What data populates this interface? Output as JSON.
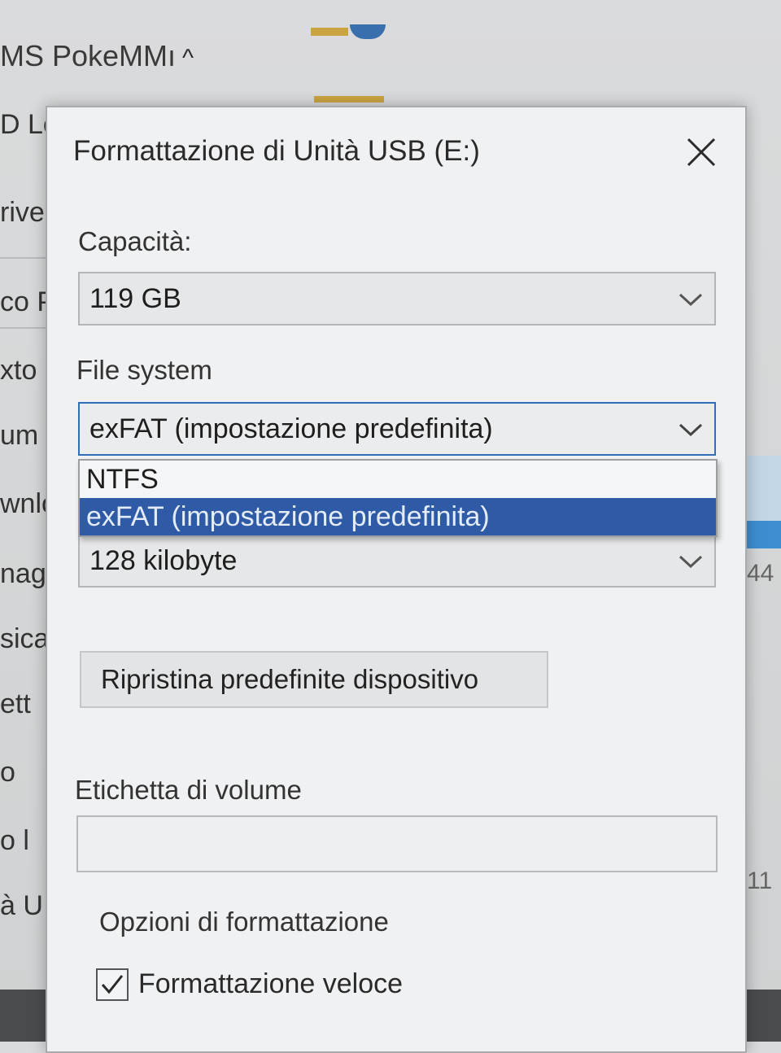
{
  "background": {
    "window_title": "MS PokeMMı",
    "sidebar_items": [
      "D Lo",
      "rive",
      "co P",
      "xto",
      "um",
      "wnlo",
      "nag",
      "sica",
      "ett",
      "o",
      "o l",
      "à U"
    ],
    "right_values": [
      "44",
      "11"
    ]
  },
  "dialog": {
    "title": "Formattazione di Unità USB (E:)",
    "capacity": {
      "label": "Capacità:",
      "value": "119 GB"
    },
    "file_system": {
      "label": "File system",
      "value": "exFAT (impostazione predefinita)",
      "options": [
        "NTFS",
        "exFAT (impostazione predefinita)"
      ],
      "selected_index": 1
    },
    "allocation_unit": {
      "value": "128 kilobyte"
    },
    "restore_defaults_label": "Ripristina predefinite dispositivo",
    "volume_label": {
      "label": "Etichetta di volume",
      "value": ""
    },
    "format_options": {
      "label": "Opzioni di formattazione",
      "quick_format_label": "Formattazione veloce",
      "quick_format_checked": true
    }
  },
  "colors": {
    "accent": "#2f6fb7",
    "selection": "#2e5aa6"
  }
}
